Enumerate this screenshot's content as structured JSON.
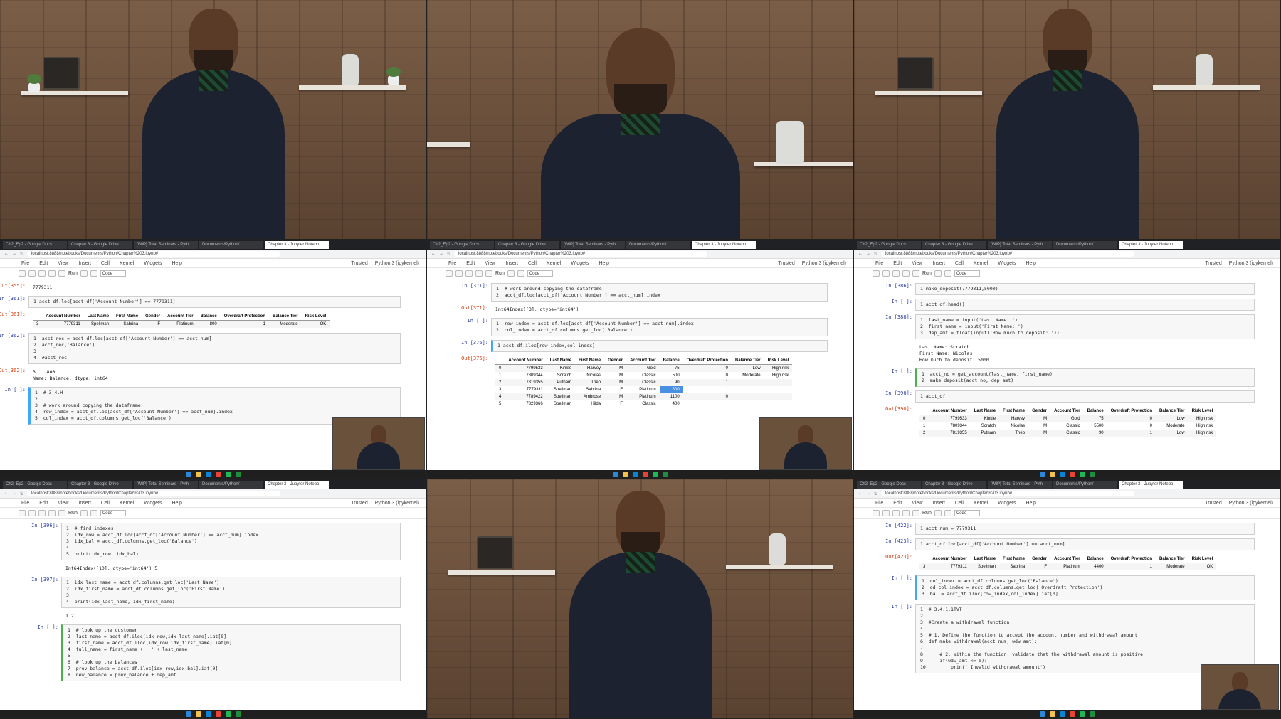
{
  "browser": {
    "tabs": [
      "Ch2_Ep2 - Google Docs",
      "Chapter 3 - Google Drive",
      "[WIP] Total Seminars - Pyth",
      "Documents/Python/",
      "Chapter 3 - Jupyter Notebo"
    ],
    "url": "localhost:8888/notebooks/Documents/Python/Chapter%203.ipynb#"
  },
  "notebook": {
    "menu": [
      "File",
      "Edit",
      "View",
      "Insert",
      "Cell",
      "Kernel",
      "Widgets",
      "Help"
    ],
    "trusted": "Trusted",
    "kernel": "Python 3 (ipykernel)",
    "run_label": "Run",
    "cell_type": "Code"
  },
  "table_headers": [
    "Account Number",
    "Last Name",
    "First Name",
    "Gender",
    "Account Tier",
    "Balance",
    "Overdraft Protection",
    "Balance Tier",
    "Risk Level"
  ],
  "screen1": {
    "cells": [
      {
        "prompt": "Out[355]:",
        "type": "out",
        "text": "7779311"
      },
      {
        "prompt": "In [361]:",
        "type": "in",
        "text": "1  acct_df.loc[acct_df['Account Number'] == 7779311]"
      },
      {
        "prompt": "Out[361]:",
        "type": "out",
        "text": ""
      },
      {
        "prompt": "In [362]:",
        "type": "in",
        "text": "1  acct_rec = acct_df.loc[acct_df['Account Number'] == acct_num]\n2  acct_rec['Balance']\n3\n4  #acct_rec"
      },
      {
        "prompt": "Out[362]:",
        "type": "out",
        "text": "3    800\nName: Balance, dtype: int64"
      },
      {
        "prompt": "In [ ]:",
        "type": "in",
        "text": "1  # 3.4.H\n2\n3  # work around copying the dataframe\n4  row_index = acct_df.loc[acct_df['Account Number'] == acct_num].index\n5  col_index = acct_df.columns.get_loc('Balance')"
      }
    ],
    "row": [
      "3",
      "7779311",
      "Spellman",
      "Sabrina",
      "F",
      "Platinum",
      "800",
      "1",
      "Moderate",
      "OK"
    ]
  },
  "screen2": {
    "cells": [
      {
        "prompt": "In [371]:",
        "type": "in",
        "text": "1  # work around copying the dataframe\n2  acct_df.loc[acct_df['Account Number'] == acct_num].index"
      },
      {
        "prompt": "Out[371]:",
        "type": "out",
        "text": "Int64Index([3], dtype='int64')"
      },
      {
        "prompt": "In [ ]:",
        "type": "in",
        "text": "1  row_index = acct_df.loc[acct_df['Account Number'] == acct_num].index\n2  col_index = acct_df.columns.get_loc('Balance')"
      },
      {
        "prompt": "In [376]:",
        "type": "in",
        "text": "1  acct_df.iloc[row_index,col_index]"
      },
      {
        "prompt": "Out[376]:",
        "type": "out",
        "text": ""
      }
    ],
    "rows": [
      [
        "0",
        "7799533",
        "Kinkle",
        "Harvey",
        "M",
        "Gold",
        "75",
        "0",
        "Low",
        "High risk"
      ],
      [
        "1",
        "7809344",
        "Scratch",
        "Nicolas",
        "M",
        "Classic",
        "500",
        "0",
        "Moderate",
        "High risk"
      ],
      [
        "2",
        "7819355",
        "Putnam",
        "Theo",
        "M",
        "Classic",
        "90",
        "1",
        "",
        ""
      ],
      [
        "3",
        "7779311",
        "Spellman",
        "Sabrina",
        "F",
        "Platinum",
        "800",
        "1",
        "",
        ""
      ],
      [
        "4",
        "7789422",
        "Spellman",
        "Ambrose",
        "M",
        "Platinum",
        "1100",
        "0",
        "",
        ""
      ],
      [
        "5",
        "7829366",
        "Spellman",
        "Hilda",
        "F",
        "Classic",
        "400",
        "",
        "",
        ""
      ]
    ]
  },
  "screen3": {
    "cells": [
      {
        "prompt": "In [386]:",
        "type": "in",
        "text": "1  make_deposit(7779311,5000)"
      },
      {
        "prompt": "In [ ]:",
        "type": "in",
        "text": "1  acct_df.head()"
      },
      {
        "prompt": "In [388]:",
        "type": "in",
        "text": "1  last_name = input('Last Name: ')\n2  first_name = input('First Name: ')\n3  dep_amt = float(input('How much to deposit: '))"
      },
      {
        "prompt": "",
        "type": "out",
        "text": "Last Name: Scratch\nFirst Name: Nicolas\nHow much to deposit: 5000"
      },
      {
        "prompt": "In [ ]:",
        "type": "in",
        "text": "1  acct_no = get_account(last_name, first_name)\n2  make_deposit(acct_no, dep_amt)"
      },
      {
        "prompt": "In [390]:",
        "type": "in",
        "text": "1  acct_df"
      },
      {
        "prompt": "Out[390]:",
        "type": "out",
        "text": ""
      }
    ],
    "rows": [
      [
        "0",
        "7799533",
        "Kinkle",
        "Harvey",
        "M",
        "Gold",
        "75",
        "0",
        "Low",
        "High risk"
      ],
      [
        "1",
        "7809344",
        "Scratch",
        "Nicolas",
        "M",
        "Classic",
        "5500",
        "0",
        "Moderate",
        "High risk"
      ],
      [
        "2",
        "7819355",
        "Putnam",
        "Theo",
        "M",
        "Classic",
        "90",
        "1",
        "Low",
        "High risk"
      ]
    ]
  },
  "screen4": {
    "cells": [
      {
        "prompt": "In [396]:",
        "type": "in",
        "text": "1  # find indexes\n2  idx_row = acct_df.loc[acct_df['Account Number'] == acct_num].index\n3  idx_bal = acct_df.columns.get_loc('Balance')\n4\n5  print(idx_row, idx_bal)"
      },
      {
        "prompt": "",
        "type": "out",
        "text": "Int64Index([10], dtype='int64') 5"
      },
      {
        "prompt": "In [397]:",
        "type": "in",
        "text": "1  idx_last_name = acct_df.columns.get_loc('Last Name')\n2  idx_first_name = acct_df.columns.get_loc('First Name')\n3\n4  print(idx_last_name, idx_first_name)"
      },
      {
        "prompt": "",
        "type": "out",
        "text": "1 2"
      },
      {
        "prompt": "In [ ]:",
        "type": "in",
        "text": "1  # look up the customer\n2  last_name = acct_df.iloc[idx_row,idx_last_name].iat[0]\n3  first_name = acct_df.iloc[idx_row,idx_first_name].iat[0]\n4  full_name = first_name + ' ' + last_name\n5\n6  # look up the balances\n7  prev_balance = acct_df.iloc[idx_row,idx_bal].iat[0]\n8  new_balance = prev_balance + dep_amt"
      }
    ]
  },
  "screen5": {
    "cells": [
      {
        "prompt": "In [422]:",
        "type": "in",
        "text": "1  acct_num = 7779311"
      },
      {
        "prompt": "In [423]:",
        "type": "in",
        "text": "1  acct_df.loc[acct_df['Account Number'] == acct_num]"
      },
      {
        "prompt": "Out[423]:",
        "type": "out",
        "text": ""
      },
      {
        "prompt": "In [ ]:",
        "type": "in",
        "text": "1  col_index = acct_df.columns.get_loc('Balance')\n2  od_col_index = acct_df.columns.get_loc('Overdraft Protection')\n3  bal = acct_df.iloc[row_index,col_index].iat[0]"
      },
      {
        "prompt": "In [ ]:",
        "type": "in",
        "text": "1  # 3.4.1.1TVT\n2\n3  #Create a withdrawal function\n4\n5  # 1. Define the function to accept the account number and withdrawal amount\n6  def make_withdrawal(acct_num, wdw_amt):\n7\n8      # 2. Within the function, validate that the withdrawal amount is positive\n9      if(wdw_amt <= 0):\n10         print('Invalid withdrawal amount')"
      }
    ],
    "row": [
      "3",
      "7779311",
      "Spellman",
      "Sabrina",
      "F",
      "Platinum",
      "4400",
      "1",
      "Moderate",
      "OK"
    ]
  }
}
